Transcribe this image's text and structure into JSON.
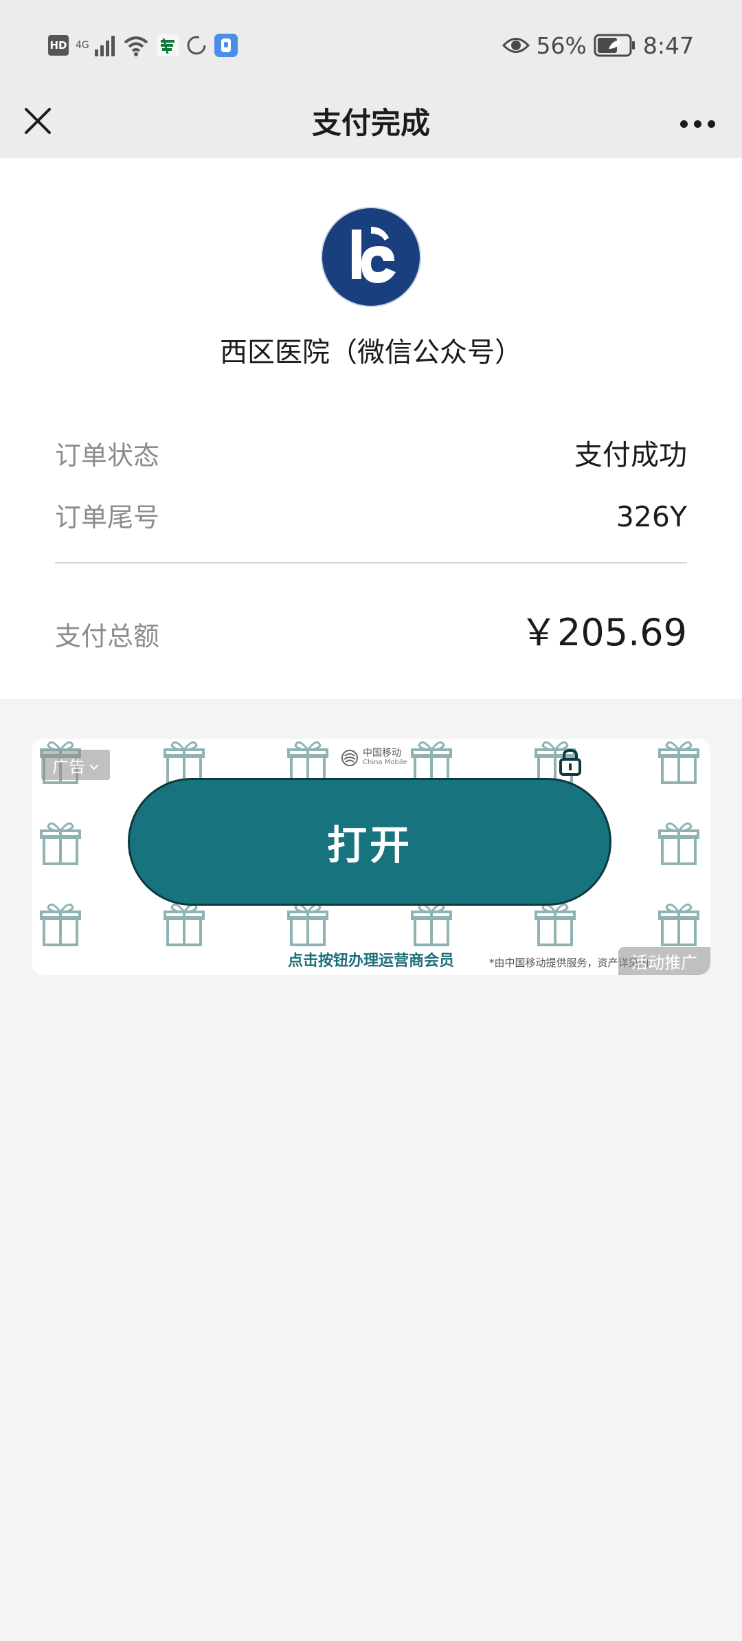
{
  "status_bar": {
    "hd": "HD",
    "network_type": "4G",
    "battery_percent": "56%",
    "time": "8:47",
    "icons": [
      "signal-icon",
      "wifi-icon",
      "post-app-icon",
      "loading-icon",
      "app-notification-icon",
      "eye-icon",
      "battery-icon"
    ]
  },
  "title_bar": {
    "title": "支付完成",
    "close_icon": "close-icon",
    "more_icon": "more-icon"
  },
  "payment": {
    "merchant_name": "西区医院（微信公众号）",
    "status_label": "订单状态",
    "status_value": "支付成功",
    "order_label": "订单尾号",
    "order_value": "326Y",
    "total_label": "支付总额",
    "total_value": "￥205.69"
  },
  "ad": {
    "tag": "广告",
    "brand_cn": "中国移动",
    "brand_en": "China Mobile",
    "button_label": "打开",
    "caption": "点击按钮办理运营商会员",
    "disclaimer": "*由中国移动提供服务，资产详见内",
    "promo_tag": "活动推广",
    "colors": {
      "button": "#17737e",
      "caption": "#1b6e7a",
      "gift": "#8fb3b2"
    }
  },
  "colors": {
    "header_bg": "#ececec",
    "merchant_logo": "#1a3f7e"
  }
}
